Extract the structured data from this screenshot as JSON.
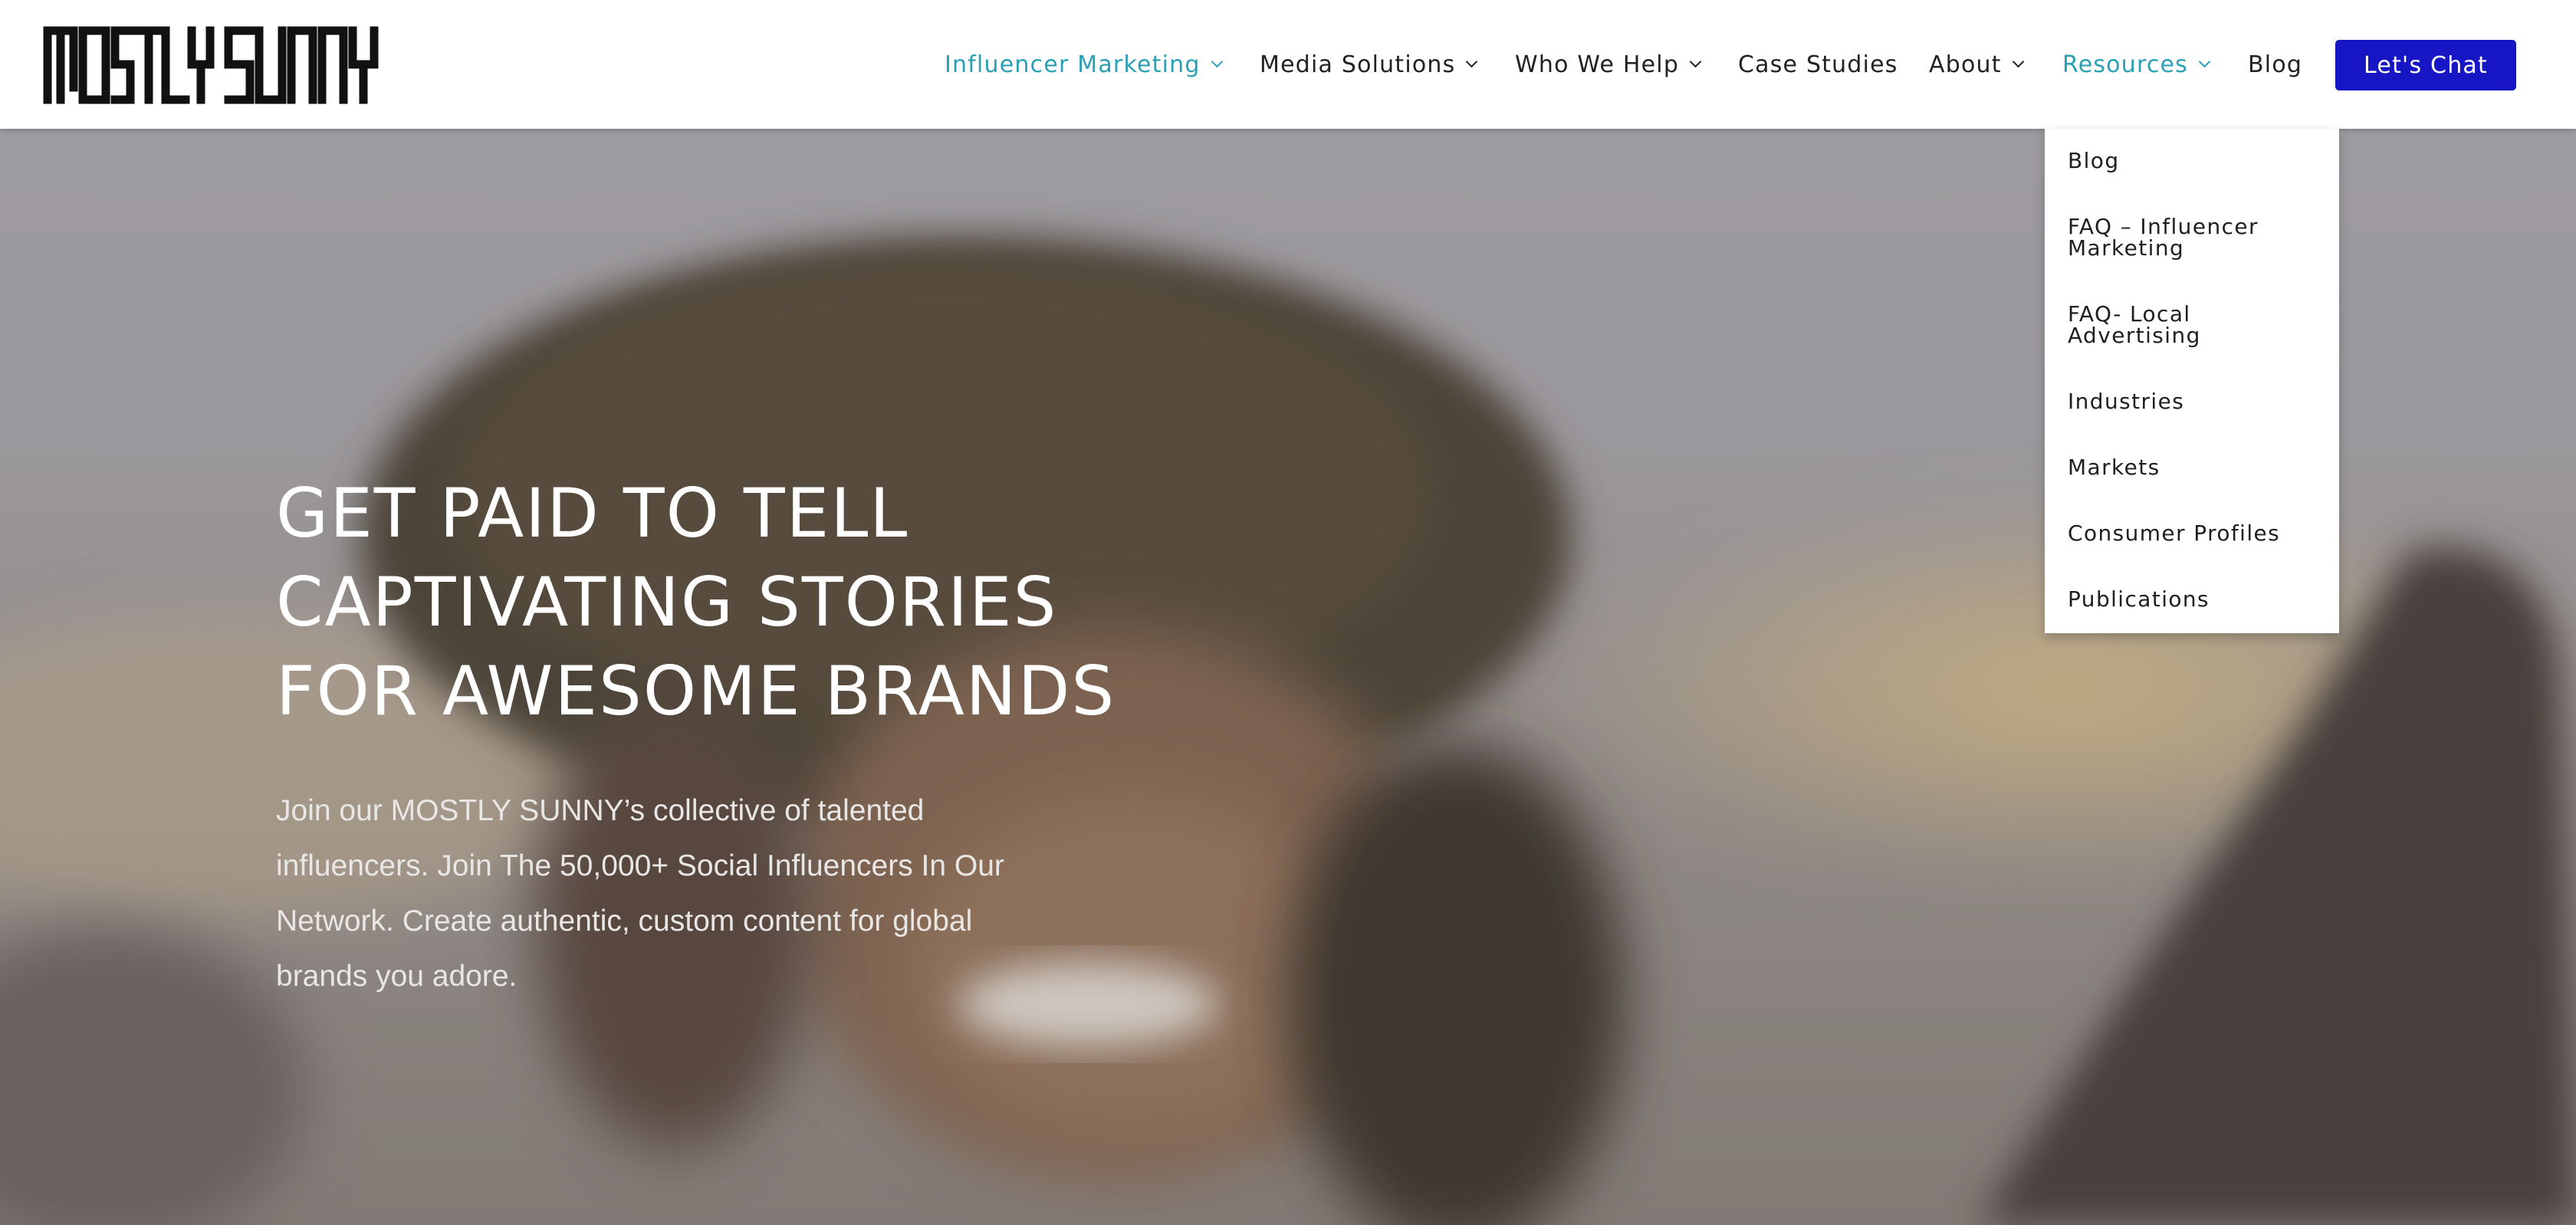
{
  "brand": {
    "logo_text": "MOSTLY SUNNY",
    "accent_color": "#2aa0b5",
    "cta_color": "#1616c4"
  },
  "nav": {
    "items": [
      {
        "label": "Influencer Marketing",
        "has_dropdown": true,
        "active": true
      },
      {
        "label": "Media Solutions",
        "has_dropdown": true,
        "active": false
      },
      {
        "label": "Who We Help",
        "has_dropdown": true,
        "active": false
      },
      {
        "label": "Case Studies",
        "has_dropdown": false,
        "active": false
      },
      {
        "label": "About",
        "has_dropdown": true,
        "active": false
      },
      {
        "label": "Resources",
        "has_dropdown": true,
        "active": true
      },
      {
        "label": "Blog",
        "has_dropdown": false,
        "active": false
      }
    ],
    "cta_label": "Let's Chat",
    "chevron_icon": "chevron-down-icon"
  },
  "resources_menu": {
    "items": [
      "Blog",
      "FAQ – Influencer Marketing",
      "FAQ- Local Advertising",
      "Industries",
      "Markets",
      "Consumer Profiles",
      "Publications"
    ]
  },
  "hero": {
    "title_lines": [
      "GET PAID TO TELL",
      "CAPTIVATING STORIES",
      "FOR AWESOME BRANDS"
    ],
    "subtitle": "Join our MOSTLY SUNNY’s collective of talented influencers. Join The 50,000+ Social Influencers In Our Network. Create authentic, custom content for global brands you adore."
  }
}
